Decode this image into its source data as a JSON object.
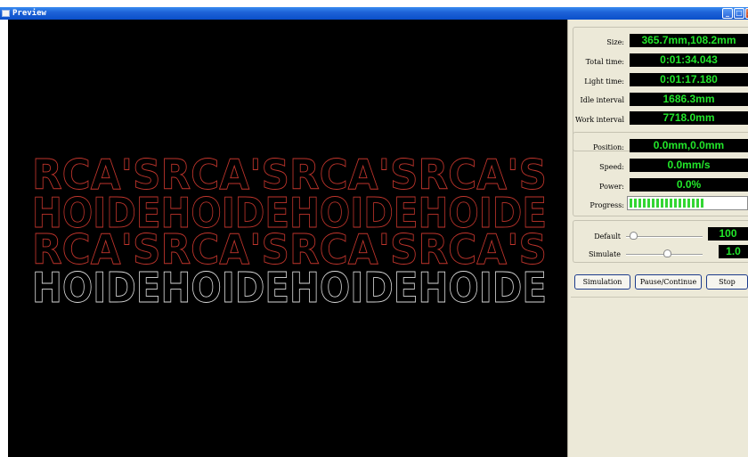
{
  "window": {
    "title": "Preview",
    "minimize_glyph": "_",
    "maximize_glyph": "□",
    "close_glyph": "x"
  },
  "canvas": {
    "rows": [
      {
        "text": "RCA'SRCA'SRCA'SRCA'S",
        "color": "#c0352c"
      },
      {
        "text": "HOIDEHOIDEHOIDEHOIDE",
        "color": "#c0352c"
      },
      {
        "text": "RCA'SRCA'SRCA'SRCA'S",
        "color": "#c0352c"
      },
      {
        "text": "HOIDEHOIDEHOIDEHOIDE",
        "color": "#d8d8d8"
      }
    ]
  },
  "stats": {
    "size_label": "Size:",
    "size_value": "365.7mm,108.2mm",
    "total_time_label": "Total time:",
    "total_time_value": "0:01:34.043",
    "light_time_label": "Light time:",
    "light_time_value": "0:01:17.180",
    "idle_label": "Idle interval",
    "idle_value": "1686.3mm",
    "work_label": "Work interval",
    "work_value": "7718.0mm"
  },
  "status": {
    "position_label": "Position:",
    "position_value": "0.0mm,0.0mm",
    "speed_label": "Speed:",
    "speed_value": "0.0mm/s",
    "power_label": "Power:",
    "power_value": "0.0%",
    "progress_label": "Progress:",
    "progress_fraction": 0.65
  },
  "sliders": {
    "default_label": "Default",
    "default_value": "100",
    "default_level": 0.05,
    "simulate_label": "Simulate",
    "simulate_value": "1.0",
    "simulate_level": 0.52
  },
  "buttons": {
    "simulation": "Simulation",
    "pause": "Pause/Continue",
    "stop": "Stop"
  },
  "colors": {
    "lcd_text": "#22e62a",
    "progress": "#33d633",
    "titlebar": "#0a4fc9"
  }
}
